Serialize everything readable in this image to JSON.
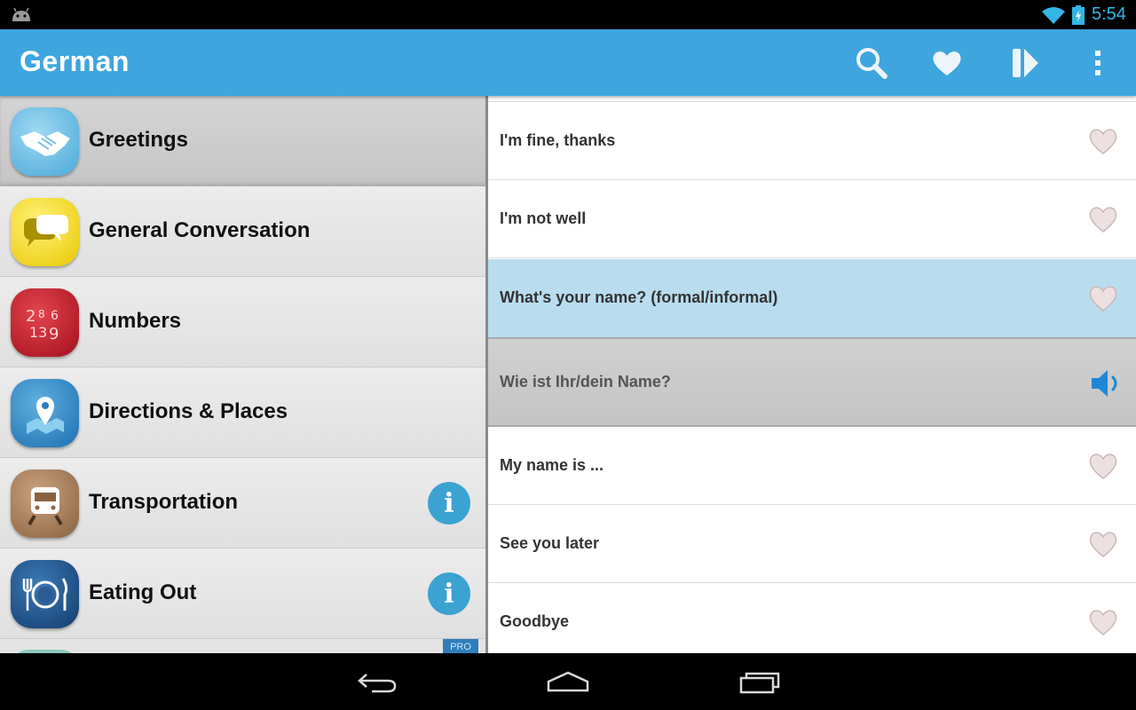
{
  "status_bar": {
    "time": "5:54",
    "icons": [
      "android-icon",
      "wifi-icon",
      "battery-charging-icon"
    ]
  },
  "action_bar": {
    "title": "German",
    "actions": [
      "search-icon",
      "heart-icon",
      "play-icon",
      "overflow-menu-icon"
    ]
  },
  "categories": [
    {
      "label": "Greetings",
      "icon": "handshake-icon",
      "selected": true,
      "info": false
    },
    {
      "label": "General Conversation",
      "icon": "speech-bubbles-icon",
      "selected": false,
      "info": false
    },
    {
      "label": "Numbers",
      "icon": "numbers-icon",
      "selected": false,
      "info": false
    },
    {
      "label": "Directions & Places",
      "icon": "map-pin-icon",
      "selected": false,
      "info": false
    },
    {
      "label": "Transportation",
      "icon": "train-icon",
      "selected": false,
      "info": true
    },
    {
      "label": "Eating Out",
      "icon": "plate-cutlery-icon",
      "selected": false,
      "info": true
    }
  ],
  "pro_badge": "PRO",
  "phrases": {
    "p1": "I'm fine, thanks",
    "p2": "I'm not well",
    "p3": "What's your name? (formal/informal)",
    "translation": "Wie ist Ihr/dein Name?",
    "p4": "My name is ...",
    "p5": "See you later",
    "p6": "Goodbye"
  },
  "nav_bar": [
    "back-icon",
    "home-icon",
    "recent-apps-icon"
  ],
  "colors": {
    "action_bar": "#3ea5de",
    "highlight": "#b9dcef",
    "accent": "#33b5e5"
  }
}
